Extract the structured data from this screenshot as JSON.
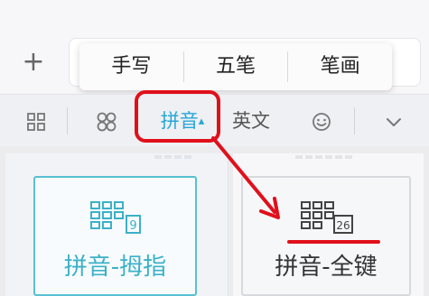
{
  "top": {
    "plus_label": "+"
  },
  "popup": {
    "items": [
      {
        "label": "手写"
      },
      {
        "label": "五笔"
      },
      {
        "label": "笔画"
      }
    ]
  },
  "toolbar": {
    "pinyin_label": "拼音",
    "pinyin_caret": "▴",
    "english_label": "英文"
  },
  "cards": [
    {
      "label": "拼音-拇指",
      "badge": "9"
    },
    {
      "label": "拼音-全键",
      "badge": "26"
    }
  ],
  "colors": {
    "accent": "#28a6d8",
    "annotation_red": "#e0101b",
    "selected_card_border": "#58c0d3"
  },
  "icons": [
    "plus-icon",
    "grid-icon",
    "clover-icon",
    "smile-icon",
    "chevron-down-icon",
    "arrow-annotation-icon"
  ]
}
